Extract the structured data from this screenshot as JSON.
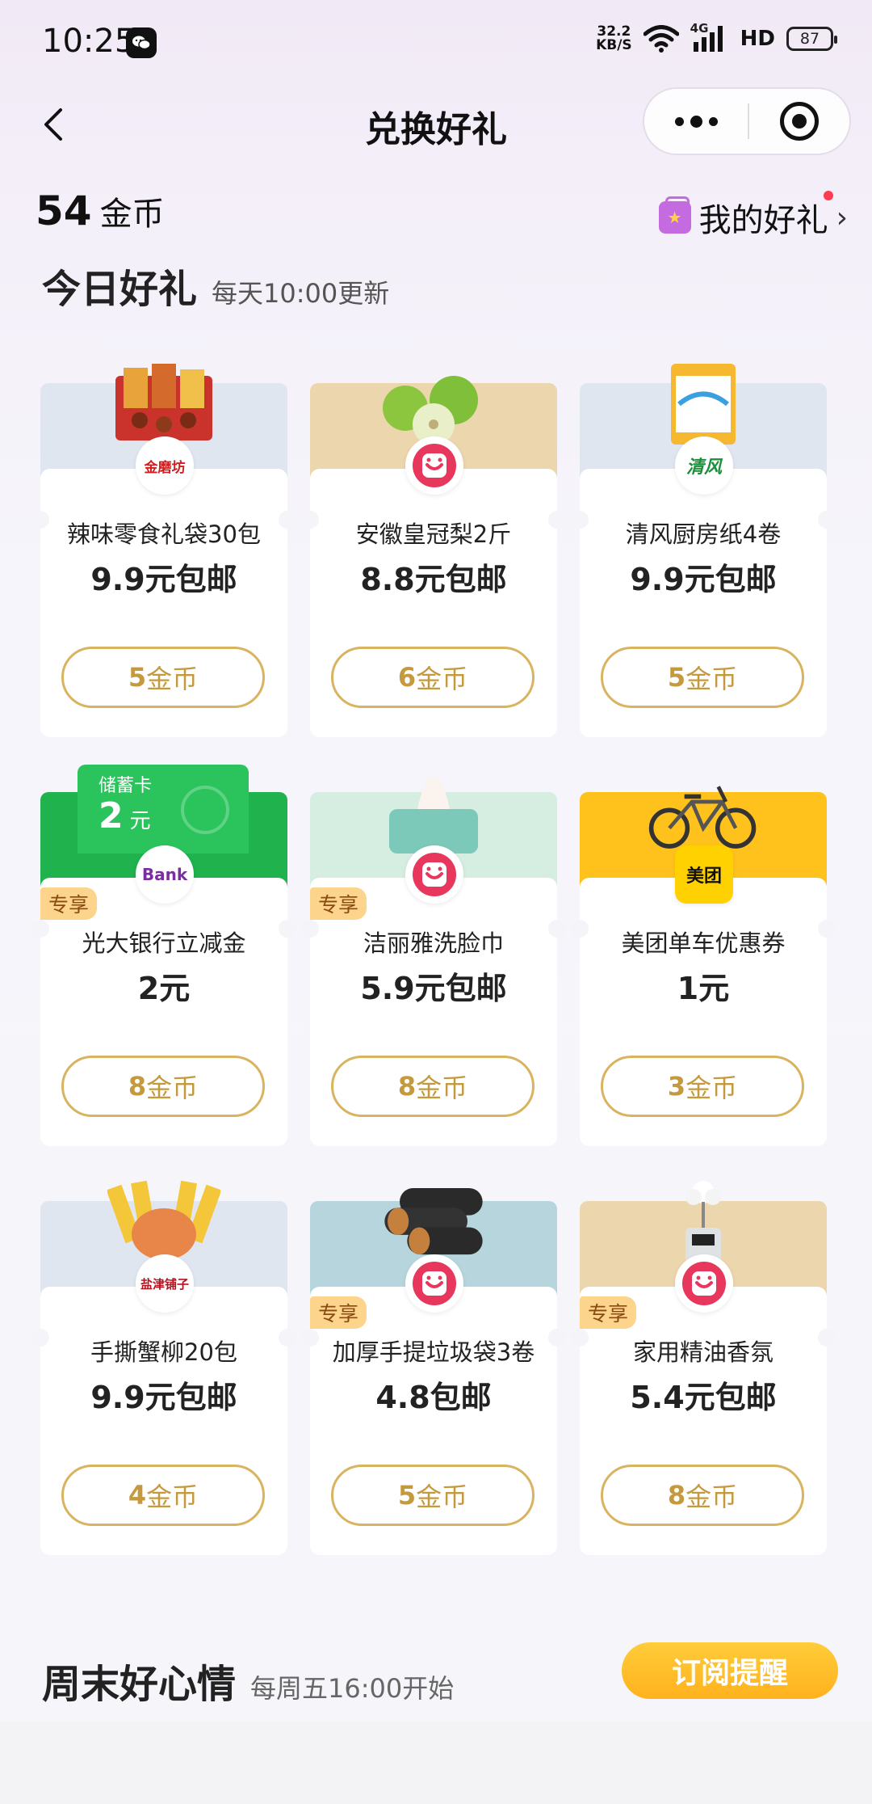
{
  "status_bar": {
    "time": "10:25",
    "net_speed_value": "32.2",
    "net_speed_unit": "KB/S",
    "signal_label": "4G",
    "hd_label": "HD",
    "battery": "87"
  },
  "nav": {
    "title": "兑换好礼"
  },
  "coins": {
    "value": "54",
    "unit": "金币"
  },
  "my_gifts": {
    "label": "我的好礼"
  },
  "today": {
    "title": "今日好礼",
    "subtitle": "每天10:00更新"
  },
  "items": [
    {
      "name": "辣味零食礼袋30包",
      "price": "9.9元包邮",
      "coins": "5",
      "coin_unit": "金币",
      "tag": "",
      "banner": "#dfe6ef",
      "logo_text": "金磨坊",
      "logo_color": "#d21e1e"
    },
    {
      "name": "安徽皇冠梨2斤",
      "price": "8.8元包邮",
      "coins": "6",
      "coin_unit": "金币",
      "tag": "",
      "banner": "#ecd6ae",
      "logo_text": "",
      "logo_color": "#e8375c"
    },
    {
      "name": "清风厨房纸4卷",
      "price": "9.9元包邮",
      "coins": "5",
      "coin_unit": "金币",
      "tag": "",
      "banner": "#dfe6ef",
      "logo_text": "清风",
      "logo_color": "#1b8f3a"
    },
    {
      "name": "光大银行立减金",
      "price": "2元",
      "coins": "8",
      "coin_unit": "金币",
      "tag": "专享",
      "banner": "#1fb24d",
      "logo_text": "Bank",
      "logo_color": "#7a2ea0",
      "voucher_label": "储蓄卡",
      "voucher_amount": "2",
      "voucher_unit": "元"
    },
    {
      "name": "洁丽雅洗脸巾",
      "price": "5.9元包邮",
      "coins": "8",
      "coin_unit": "金币",
      "tag": "专享",
      "banner": "#d6ede2",
      "logo_text": "",
      "logo_color": "#e8375c"
    },
    {
      "name": "美团单车优惠券",
      "price": "1元",
      "coins": "3",
      "coin_unit": "金币",
      "tag": "",
      "banner": "#ffc21d",
      "logo_text": "美团",
      "logo_color": "#111111"
    },
    {
      "name": "手撕蟹柳20包",
      "price": "9.9元包邮",
      "coins": "4",
      "coin_unit": "金币",
      "tag": "",
      "banner": "#dfe6ef",
      "logo_text": "盐津铺子",
      "logo_color": "#b3121e"
    },
    {
      "name": "加厚手提垃圾袋3卷",
      "price": "4.8包邮",
      "coins": "5",
      "coin_unit": "金币",
      "tag": "专享",
      "banner": "#b6d5dd",
      "logo_text": "",
      "logo_color": "#e8375c"
    },
    {
      "name": "家用精油香氛",
      "price": "5.4元包邮",
      "coins": "8",
      "coin_unit": "金币",
      "tag": "专享",
      "banner": "#ecd6ae",
      "logo_text": "",
      "logo_color": "#e8375c"
    }
  ],
  "weekend": {
    "title": "周末好心情",
    "subtitle": "每周五16:00开始",
    "subscribe_label": "订阅提醒"
  }
}
